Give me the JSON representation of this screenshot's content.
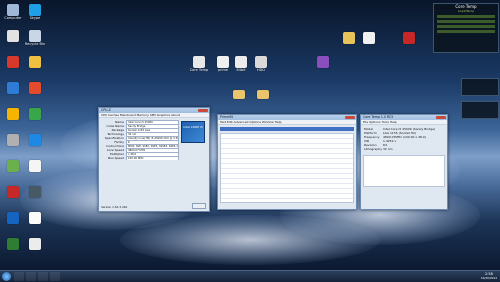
{
  "desktop": {
    "left_icons": [
      {
        "label": "Computer",
        "color": "#9fb8d8"
      },
      {
        "label": "Skype",
        "color": "#1ea0e6"
      },
      {
        "label": "",
        "color": "#e2e2e2"
      },
      {
        "label": "Recycle Bin",
        "color": "#c9d6e6"
      },
      {
        "label": "",
        "color": "#d8392b"
      },
      {
        "label": "",
        "color": "#f0c040"
      },
      {
        "label": "",
        "color": "#2f7cd6"
      },
      {
        "label": "",
        "color": "#e34b2c"
      },
      {
        "label": "",
        "color": "#f4b400"
      },
      {
        "label": "",
        "color": "#3aa64a"
      },
      {
        "label": "",
        "color": "#b0b0b0"
      },
      {
        "label": "",
        "color": "#1e88e5"
      },
      {
        "label": "",
        "color": "#6ab04c"
      },
      {
        "label": "",
        "color": "#f5f5f5"
      },
      {
        "label": "",
        "color": "#c62828"
      },
      {
        "label": "",
        "color": "#455a64"
      },
      {
        "label": "",
        "color": "#1565c0"
      },
      {
        "label": "",
        "color": "#fafafa"
      },
      {
        "label": "",
        "color": "#2e7d32"
      },
      {
        "label": "",
        "color": "#ececec"
      }
    ],
    "top_icons": [
      {
        "label": "Core Temp",
        "color": "#e8e8e8"
      },
      {
        "label": "prime",
        "color": "#f0f0f0"
      },
      {
        "label": "64bit",
        "color": "#ececec"
      },
      {
        "label": "HDD",
        "color": "#d9d9d9"
      }
    ],
    "right_icons": [
      {
        "label": "",
        "color": "#e7c35a"
      },
      {
        "label": "",
        "color": "#f0f0f0"
      },
      {
        "label": "",
        "color": "#8a4fbf"
      },
      {
        "label": "",
        "color": "#c62828"
      }
    ],
    "folder_icons": [
      {
        "label": "",
        "color": "#e9c46a"
      },
      {
        "label": "",
        "color": "#e9c46a"
      }
    ]
  },
  "cpuz": {
    "title": "CPU-Z",
    "tabs": "CPU  Caches  Mainboard  Memory  SPD  Graphics  About",
    "rows": [
      [
        "Name",
        "Intel Core i5 2500K"
      ],
      [
        "Code Name",
        "Sandy Bridge"
      ],
      [
        "Package",
        "Socket 1155 LGA"
      ],
      [
        "Technology",
        "32 nm"
      ],
      [
        "Specification",
        "Intel(R) Core(TM) i5-2500K CPU @ 3.30GHz"
      ],
      [
        "Family",
        "6"
      ],
      [
        "Instructions",
        "MMX, SSE, SSE2, SSE3, SSSE3, SSE4.1, SSE4.2, EM64T, VT-x, AES, AVX"
      ],
      [
        "Core Speed",
        "4800.07 MHz"
      ],
      [
        "Multiplier",
        "x 48.0"
      ],
      [
        "Bus Speed",
        "100.00 MHz"
      ]
    ],
    "footer": "Version 1.61.3.x64",
    "brand": "intel CORE i5"
  },
  "prime": {
    "title": "Prime95",
    "menu": "Test  Edit  Advanced  Options  Window  Help",
    "row_count": 14
  },
  "coretemp": {
    "title": "Core Temp 1.0 RC5",
    "menu": "File  Options  Tools  Help",
    "rows": [
      [
        "Model",
        "Intel Core i5 2500K (Sandy Bridge)"
      ],
      [
        "Platform",
        "LGA 1155 (Socket H2)"
      ],
      [
        "Frequency",
        "4800.07MHz (100.00 x 48.0)"
      ],
      [
        "VID",
        "1.4252 v"
      ],
      [
        "Revision",
        "D2"
      ],
      [
        "Lithography",
        "32 nm"
      ]
    ]
  },
  "gadgets": {
    "core_temp_title": "Core Temp",
    "core_temp_sub": "Load/Temp"
  },
  "taskbar": {
    "time": "2:58",
    "date": "10/20/2012"
  }
}
